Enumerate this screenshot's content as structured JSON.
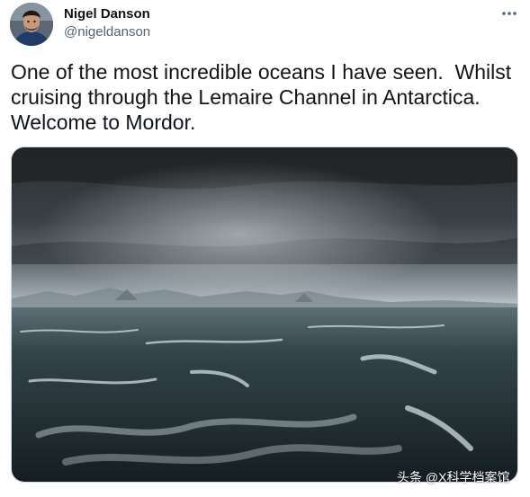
{
  "author": {
    "name": "Nigel Danson",
    "handle": "@nigeldanson"
  },
  "icons": {
    "more": "more-horizontal-icon",
    "avatar": "avatar-photo"
  },
  "tweet": {
    "text": "One of the most incredible oceans I have seen.  Whilst cruising through the Lemaire Channel in Antarctica. Welcome to Mordor."
  },
  "media": {
    "type": "photo",
    "watermark": "头条 @X科学档案馆"
  },
  "colors": {
    "text": "#0f1419",
    "secondary": "#536471",
    "border": "#cfd9de"
  }
}
